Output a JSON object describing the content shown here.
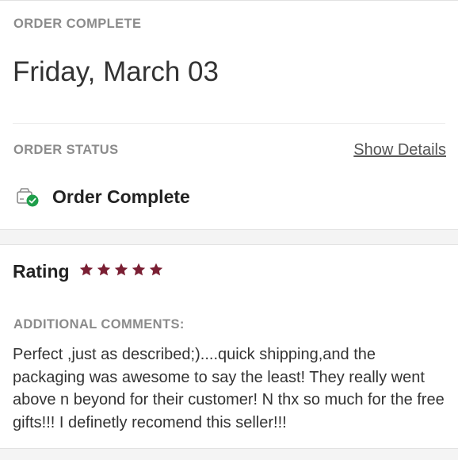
{
  "order": {
    "header_label": "ORDER COMPLETE",
    "date": "Friday, March 03",
    "status_label": "ORDER STATUS",
    "show_details": "Show Details",
    "status": "Order Complete"
  },
  "review": {
    "rating_label": "Rating",
    "rating_value": 5,
    "rating_max": 5,
    "star_color": "#7a1f33",
    "comments_label": "ADDITIONAL COMMENTS:",
    "comments": "Perfect ,just as described;)....quick shipping,and the packaging was awesome to say the least! They really went above n beyond for their customer! N thx so much for the free gifts!!! I definetly recomend this seller!!!"
  },
  "icons": {
    "status": "package-check-icon",
    "rating": "star-icon"
  },
  "colors": {
    "success": "#1e9e4a",
    "accent": "#7a1f33"
  }
}
